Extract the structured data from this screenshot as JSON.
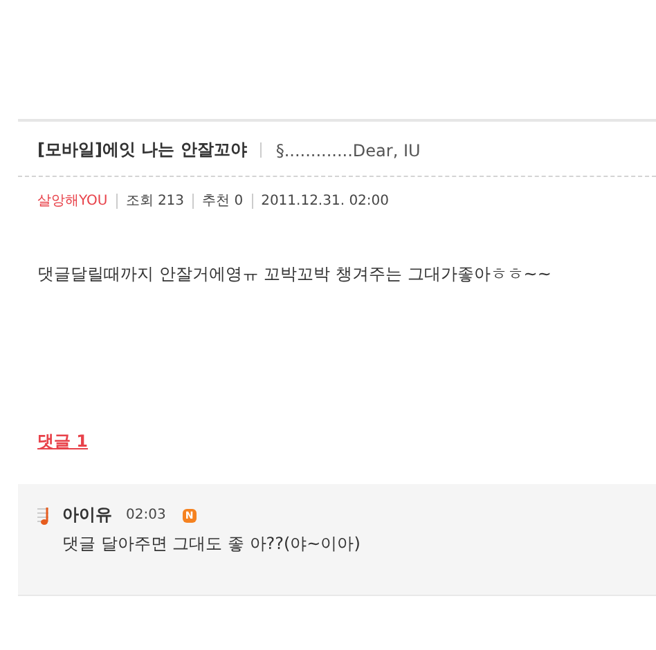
{
  "post": {
    "title": "[모바일]에잇 나는 안잘꼬야",
    "board": "§.............Dear, IU",
    "author": "살앙해YOU",
    "views": "조회 213",
    "recommends": "추천 0",
    "date": "2011.12.31. 02:00",
    "body": "댓글달릴때까지 안잘거에영ㅠ 꼬박꼬박 챙겨주는 그대가좋아ㅎㅎ~~"
  },
  "comments_link": "댓글 1",
  "comments": [
    {
      "author": "아이유",
      "time": "02:03",
      "new": true,
      "badge": "N",
      "text": "댓글 달아주면 그대도 좋 아??(야~이아)"
    }
  ]
}
